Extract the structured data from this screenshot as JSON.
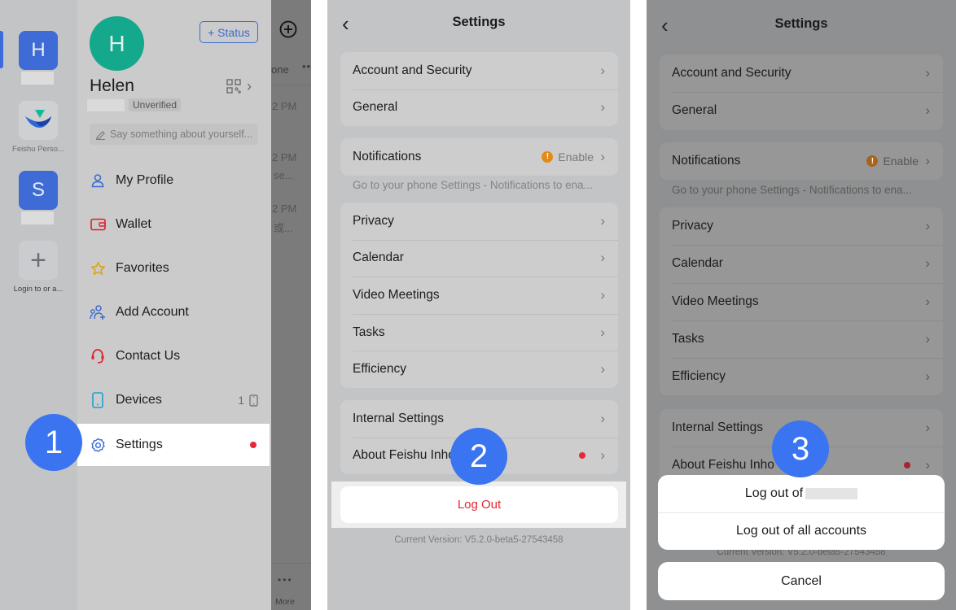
{
  "colors": {
    "accent": "#3a74f0",
    "brand_blue": "#3e6bd6",
    "avatar_green": "#14a88c",
    "danger_red": "#e3262f",
    "warning_orange": "#e48a17"
  },
  "step_badges": [
    "1",
    "2",
    "3"
  ],
  "panel1": {
    "rail": {
      "tenants": [
        {
          "initial": "H",
          "label": "",
          "active": true
        },
        {
          "initial": "",
          "label": "Feishu Perso...",
          "icon": "feishu-logo-icon"
        },
        {
          "initial": "S",
          "label": ""
        },
        {
          "initial": "+",
          "label": "Login to or a...",
          "icon": "plus-icon"
        }
      ]
    },
    "profile": {
      "avatar_initial": "H",
      "name": "Helen",
      "status_button": "+ Status",
      "verification_badge": "Unverified",
      "signature_placeholder": "Say something about yourself..."
    },
    "menu": [
      {
        "label": "My Profile",
        "icon": "person-icon",
        "color": "#3c6ad2"
      },
      {
        "label": "Wallet",
        "icon": "wallet-icon",
        "color": "#d9232b"
      },
      {
        "label": "Favorites",
        "icon": "star-icon",
        "color": "#e0a20e"
      },
      {
        "label": "Add Account",
        "icon": "add-account-icon",
        "color": "#3c6ad2"
      },
      {
        "label": "Contact Us",
        "icon": "headset-icon",
        "color": "#d9232b"
      },
      {
        "label": "Devices",
        "icon": "phone-icon",
        "color": "#1f9fd4",
        "trail": "1"
      },
      {
        "label": "Settings",
        "icon": "gear-icon",
        "color": "#3c6ad2",
        "active": true,
        "badge_dot": true
      }
    ],
    "chat_strip": {
      "tab_text": "one",
      "tab_more": "••",
      "times": [
        "2 PM",
        "2 PM",
        "2 PM"
      ],
      "snippets": [
        "se...",
        "或..."
      ],
      "more_dots": "•••",
      "more_label": "More"
    }
  },
  "settings": {
    "title": "Settings",
    "group1": [
      "Account and Security",
      "General"
    ],
    "notifications": {
      "label": "Notifications",
      "status": "Enable",
      "warn_glyph": "!"
    },
    "notifications_hint": "Go to your phone Settings - Notifications to ena...",
    "group3": [
      "Privacy",
      "Calendar",
      "Video Meetings",
      "Tasks",
      "Efficiency"
    ],
    "group4": [
      "Internal Settings",
      "About Feishu Inhouse"
    ],
    "about_truncated": "About Feishu Inho",
    "logout": "Log Out",
    "version": "Current Version: V5.2.0-beta5-27543458"
  },
  "logout_sheet": {
    "log_out_of_prefix": "Log out of",
    "log_out_all": "Log out of all accounts",
    "cancel": "Cancel"
  }
}
